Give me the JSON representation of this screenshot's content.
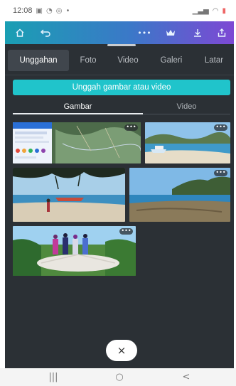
{
  "status_bar": {
    "time": "12:08",
    "left_icons": [
      "mail-icon",
      "messenger-icon",
      "whatsapp-icon",
      "dot-icon"
    ],
    "right_icons": [
      "signal-strength-icon",
      "wifi-icon",
      "battery-icon"
    ]
  },
  "app_bar": {
    "buttons": [
      "home-icon",
      "undo-icon",
      "more-dots-icon",
      "crown-icon",
      "download-icon",
      "share-icon"
    ]
  },
  "tabs": [
    {
      "label": "Unggahan",
      "active": true
    },
    {
      "label": "Foto",
      "active": false
    },
    {
      "label": "Video",
      "active": false
    },
    {
      "label": "Galeri",
      "active": false
    },
    {
      "label": "Latar",
      "active": false
    }
  ],
  "upload_button_label": "Unggah gambar atau video",
  "subtabs": [
    {
      "label": "Gambar",
      "active": true
    },
    {
      "label": "Video",
      "active": false
    }
  ],
  "thumbnails": [
    {
      "name": "thumb-map-screenshot",
      "more": "•••"
    },
    {
      "name": "thumb-beach-boat",
      "more": "•••"
    },
    {
      "name": "thumb-beach-person",
      "more": "•••"
    },
    {
      "name": "thumb-coast-hills",
      "more": "•••"
    },
    {
      "name": "thumb-group-on-platform",
      "more": "•••"
    }
  ],
  "close_button_label": "×",
  "nav_bar": {
    "recents": "|||",
    "home": "○",
    "back": "<"
  },
  "colors": {
    "panel_bg": "#2b3035",
    "accent_teal": "#20c4cb",
    "appbar_start": "#1a9fb3",
    "appbar_end": "#7d48d4"
  }
}
